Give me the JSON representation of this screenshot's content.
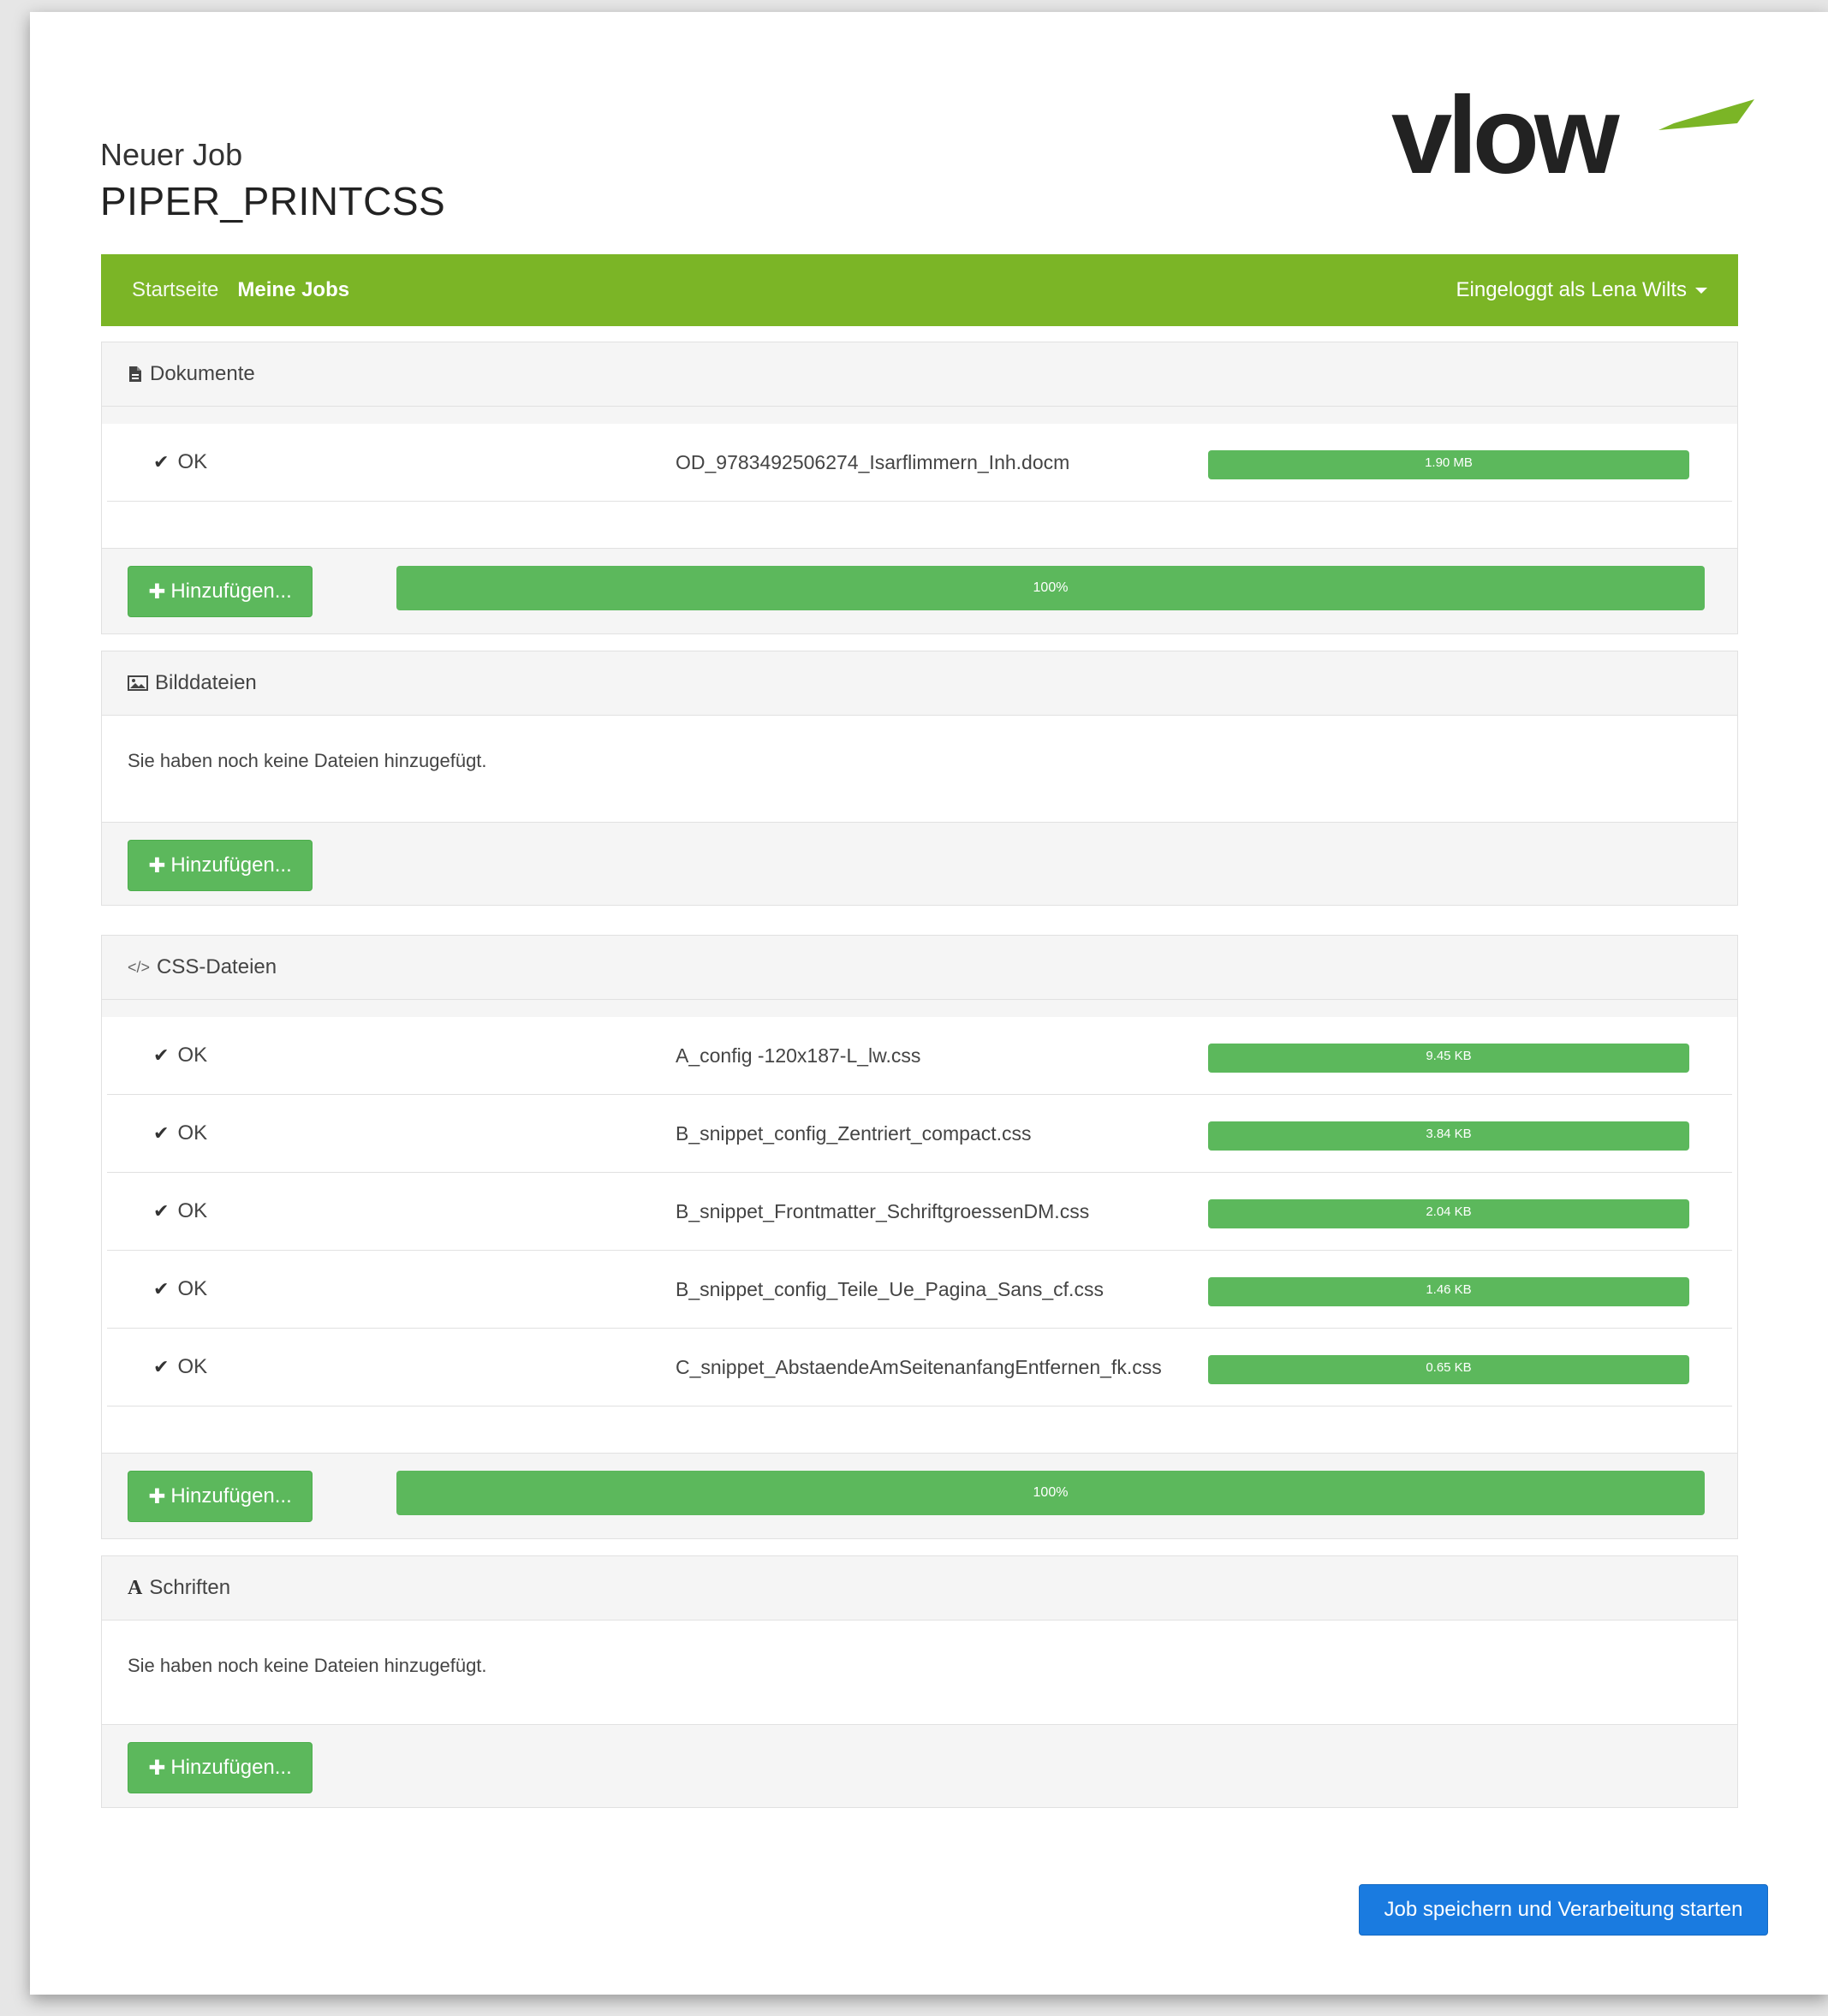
{
  "header": {
    "subtitle": "Neuer Job",
    "job_name": "PIPER_PRINTCSS",
    "logo_text": "vlow"
  },
  "navbar": {
    "links": [
      {
        "label": "Startseite"
      },
      {
        "label": "Meine Jobs"
      }
    ],
    "user_label": "Eingeloggt als Lena Wilts"
  },
  "sections": {
    "documents": {
      "title": "Dokumente",
      "files": [
        {
          "status": "OK",
          "name": "OD_9783492506274_Isarflimmern_Inh.docm",
          "size": "1.90 MB"
        }
      ],
      "add_label": "Hinzufügen...",
      "total_progress": "100%"
    },
    "images": {
      "title": "Bilddateien",
      "empty_message": "Sie haben noch keine Dateien hinzugefügt.",
      "add_label": "Hinzufügen..."
    },
    "css": {
      "title": "CSS-Dateien",
      "files": [
        {
          "status": "OK",
          "name": "A_config -120x187-L_lw.css",
          "size": "9.45 KB"
        },
        {
          "status": "OK",
          "name": "B_snippet_config_Zentriert_compact.css",
          "size": "3.84 KB"
        },
        {
          "status": "OK",
          "name": "B_snippet_Frontmatter_SchriftgroessenDM.css",
          "size": "2.04 KB"
        },
        {
          "status": "OK",
          "name": "B_snippet_config_Teile_Ue_Pagina_Sans_cf.css",
          "size": "1.46 KB"
        },
        {
          "status": "OK",
          "name": "C_snippet_AbstaendeAmSeitenanfangEntfernen_fk.css",
          "size": "0.65 KB"
        }
      ],
      "add_label": "Hinzufügen...",
      "total_progress": "100%"
    },
    "fonts": {
      "title": "Schriften",
      "empty_message": "Sie haben noch keine Dateien hinzugefügt.",
      "add_label": "Hinzufügen..."
    }
  },
  "submit_label": "Job speichern und Verarbeitung starten",
  "colors": {
    "brand_green": "#7bb526",
    "progress_green": "#5cb85c",
    "primary_blue": "#1a7be0"
  },
  "icons": {
    "documents": "file-icon",
    "images": "image-icon",
    "css": "code-icon",
    "fonts": "font-icon",
    "ok": "check-icon",
    "add": "plus-icon",
    "user_menu": "caret-down-icon"
  }
}
